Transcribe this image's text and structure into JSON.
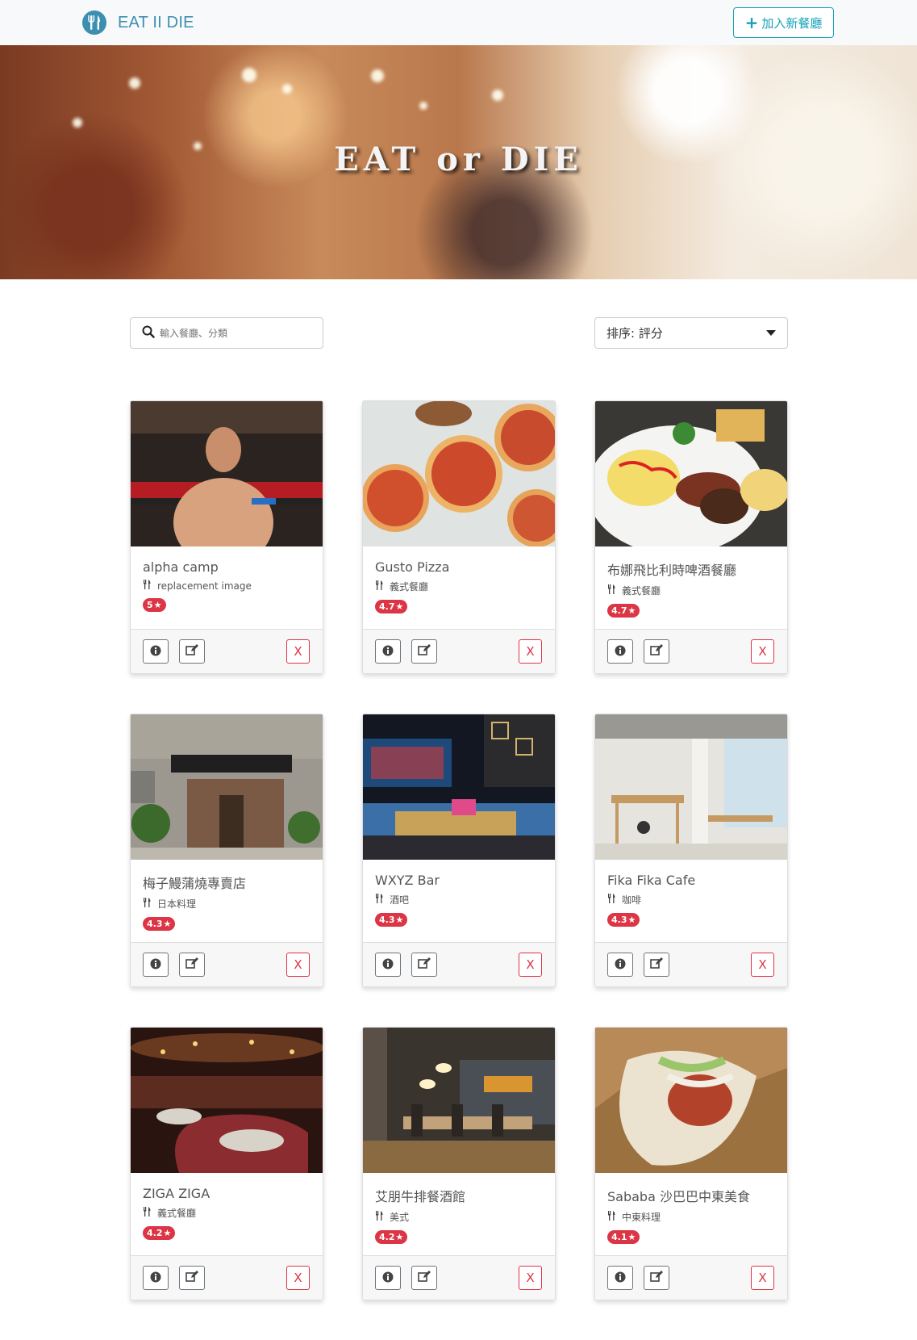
{
  "navbar": {
    "brand_text": "EAT II DIE",
    "add_button_label": "加入新餐廳",
    "add_button_icon": "plus-icon",
    "accent_color": "#17a2b8",
    "brand_color": "#3d8fb0"
  },
  "banner": {
    "title": "EAT or DIE"
  },
  "search": {
    "placeholder": "輸入餐廳、分類",
    "icon": "search-icon"
  },
  "sort": {
    "selected": "排序: 評分"
  },
  "restaurants": [
    {
      "name": "alpha camp",
      "category": "replacement image",
      "rating": "5",
      "image": "wrestler-photo"
    },
    {
      "name": "Gusto Pizza",
      "category": "義式餐廳",
      "rating": "4.7",
      "image": "pizza-photo"
    },
    {
      "name": "布娜飛比利時啤酒餐廳",
      "category": "義式餐廳",
      "rating": "4.7",
      "image": "breakfast-plate-photo"
    },
    {
      "name": "梅子鰻蒲燒專賣店",
      "category": "日本料理",
      "rating": "4.3",
      "image": "storefront-photo"
    },
    {
      "name": "WXYZ Bar",
      "category": "酒吧",
      "rating": "4.3",
      "image": "bar-interior-photo"
    },
    {
      "name": "Fika Fika Cafe",
      "category": "咖啡",
      "rating": "4.3",
      "image": "cafe-interior-photo"
    },
    {
      "name": "ZIGA ZIGA",
      "category": "義式餐廳",
      "rating": "4.2",
      "image": "restaurant-dining-photo"
    },
    {
      "name": "艾朋牛排餐酒館",
      "category": "美式",
      "rating": "4.2",
      "image": "steakhouse-photo"
    },
    {
      "name": "Sababa 沙巴巴中東美食",
      "category": "中東料理",
      "rating": "4.1",
      "image": "pita-sandwich-photo"
    }
  ],
  "card_buttons": {
    "delete_label": "X",
    "info_icon": "info-icon",
    "edit_icon": "edit-icon"
  },
  "badge_color": "#dc3545"
}
